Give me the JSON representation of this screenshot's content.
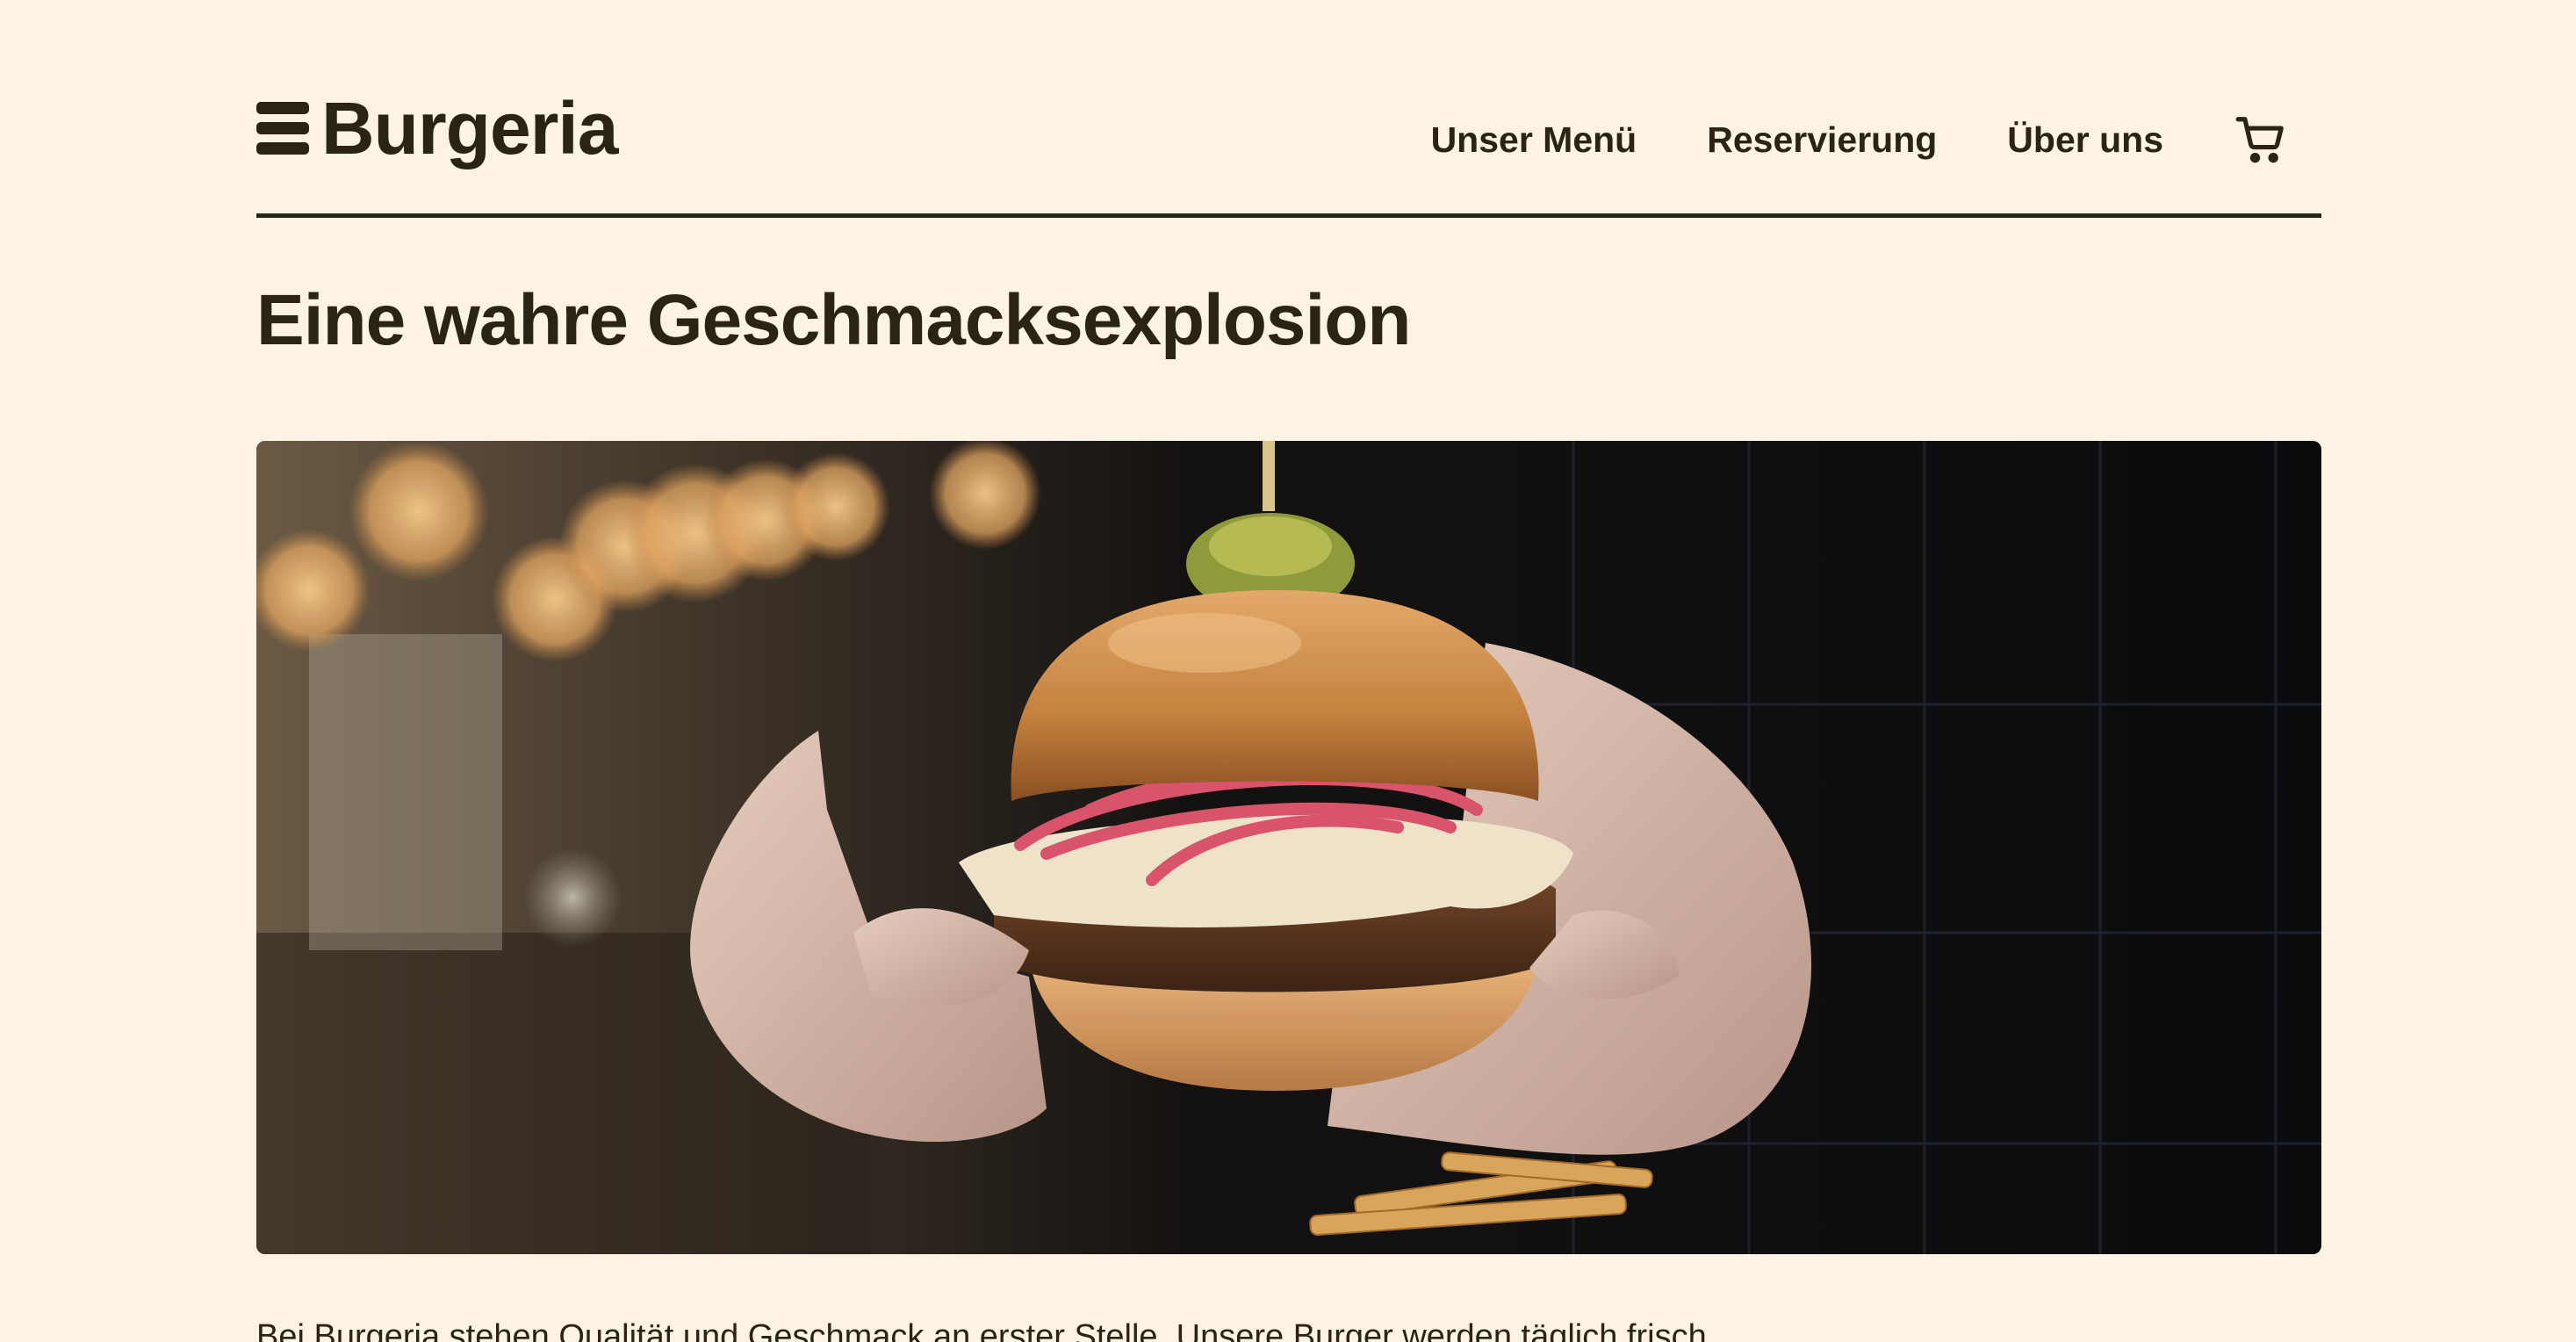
{
  "brand": {
    "name": "Burgeria",
    "logo_icon": "hamburger-menu-icon"
  },
  "nav": {
    "items": [
      {
        "label": "Unser Menü"
      },
      {
        "label": "Reservierung"
      },
      {
        "label": "Über uns"
      }
    ],
    "cart_icon": "shopping-cart-icon"
  },
  "main": {
    "title": "Eine wahre Geschmacksexplosion",
    "hero_image": "burger-photo",
    "intro": "Bei Burgeria stehen Qualität und Geschmack an erster Stelle. Unsere Burger werden täglich frisch"
  },
  "colors": {
    "background": "#fcf3e4",
    "text": "#2b2414"
  }
}
